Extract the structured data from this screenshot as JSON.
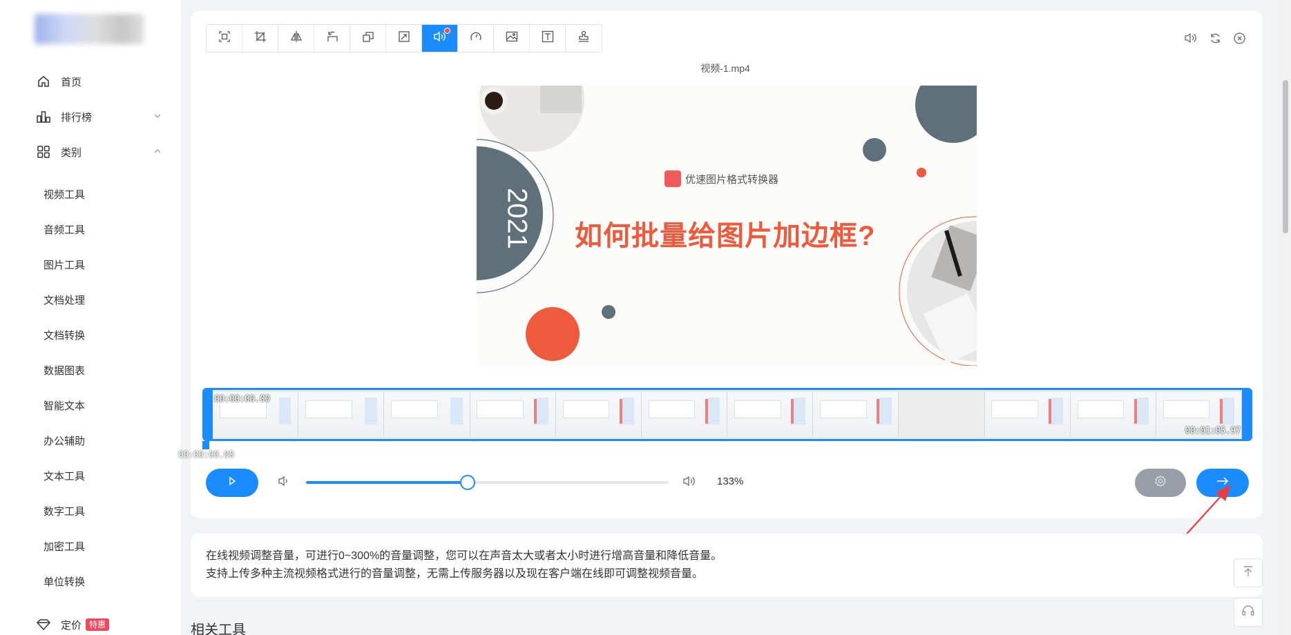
{
  "sidebar": {
    "nav": [
      {
        "label": "首页",
        "icon": "home-icon"
      },
      {
        "label": "排行榜",
        "icon": "bar-chart-icon"
      },
      {
        "label": "类别",
        "icon": "grid-icon"
      }
    ],
    "categories": [
      "视频工具",
      "音频工具",
      "图片工具",
      "文档处理",
      "文档转换",
      "数据图表",
      "智能文本",
      "办公辅助",
      "文本工具",
      "数字工具",
      "加密工具",
      "单位转换"
    ],
    "pricing": {
      "label": "定价",
      "badge": "特惠",
      "icon": "diamond-icon"
    }
  },
  "toolbar": {
    "tools": [
      "crop-icon",
      "resize-icon",
      "flip-icon",
      "rotate-icon",
      "duplicate-icon",
      "scale-icon",
      "volume-icon",
      "speed-icon",
      "image-icon",
      "text-icon",
      "stamp-icon"
    ],
    "active_index": 6
  },
  "top_right": [
    "volume-icon",
    "refresh-icon",
    "close-circle-icon"
  ],
  "file": {
    "name": "视频-1.mp4"
  },
  "slide": {
    "brand": "优速图片格式转换器",
    "title": "如何批量给图片加边框?",
    "year": "2021"
  },
  "timeline": {
    "start_time": "00:00:00.00",
    "end_time": "00:01:05.97",
    "current_time": "00:00:00.00",
    "frame_count": 12
  },
  "controls": {
    "volume_percent_label": "133%",
    "volume_fraction": 0.445
  },
  "description": {
    "line1": "在线视频调整音量，可进行0~300%的音量调整，您可以在声音太大或者太小时进行增高音量和降低音量。",
    "line2": "支持上传多种主流视频格式进行的音量调整，无需上传服务器以及现在客户端在线即可调整视频音量。"
  },
  "related_title": "相关工具",
  "colors": {
    "primary": "#1a8cff",
    "accent": "#ee5a3c",
    "badge": "#f5475c",
    "slate": "#5f707a"
  }
}
